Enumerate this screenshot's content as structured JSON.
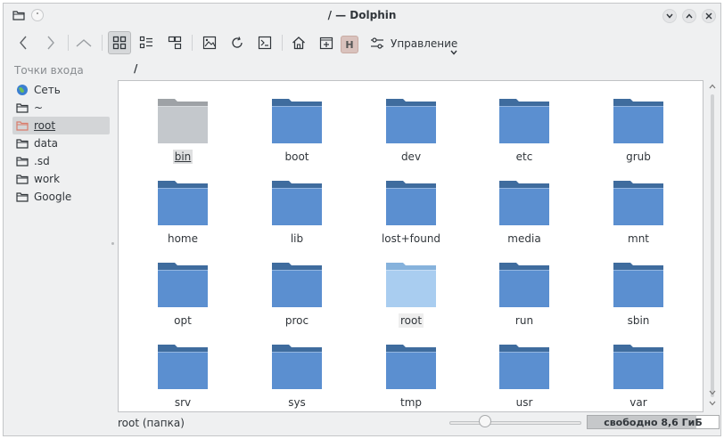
{
  "window": {
    "title": "/ — Dolphin"
  },
  "toolbar": {
    "hidden_btn": "H",
    "menu_label": "Управление"
  },
  "sidebar": {
    "title": "Точки входа",
    "items": [
      {
        "label": "Сеть",
        "icon": "network-globe-icon"
      },
      {
        "label": "~",
        "icon": "folder-icon"
      },
      {
        "label": "root",
        "icon": "folder-icon"
      },
      {
        "label": "data",
        "icon": "folder-icon"
      },
      {
        "label": ".sd",
        "icon": "folder-icon"
      },
      {
        "label": "work",
        "icon": "folder-icon"
      },
      {
        "label": "Google",
        "icon": "folder-icon"
      }
    ],
    "selected_index": 2
  },
  "breadcrumb": "/",
  "items": [
    {
      "name": "bin",
      "state": "highlighted"
    },
    {
      "name": "boot"
    },
    {
      "name": "dev"
    },
    {
      "name": "etc"
    },
    {
      "name": "grub"
    },
    {
      "name": "home"
    },
    {
      "name": "lib"
    },
    {
      "name": "lost+found"
    },
    {
      "name": "media"
    },
    {
      "name": "mnt"
    },
    {
      "name": "opt"
    },
    {
      "name": "proc"
    },
    {
      "name": "root",
      "state": "hover"
    },
    {
      "name": "run"
    },
    {
      "name": "sbin"
    },
    {
      "name": "srv"
    },
    {
      "name": "sys"
    },
    {
      "name": "tmp"
    },
    {
      "name": "usr"
    },
    {
      "name": "var"
    }
  ],
  "status": {
    "text": "root (папка)",
    "free_space": "свободно 8,6 ГиБ",
    "space_used_fraction": 0.83,
    "zoom_fraction": 0.27
  },
  "colors": {
    "folder_front": "#5b8fd0",
    "folder_back": "#3f6c9e",
    "folder_bin_front": "#c4c8cc",
    "folder_bin_back": "#9ea2a6",
    "folder_hover_front": "#a9cdf0",
    "folder_hover_back": "#86b2dc"
  }
}
